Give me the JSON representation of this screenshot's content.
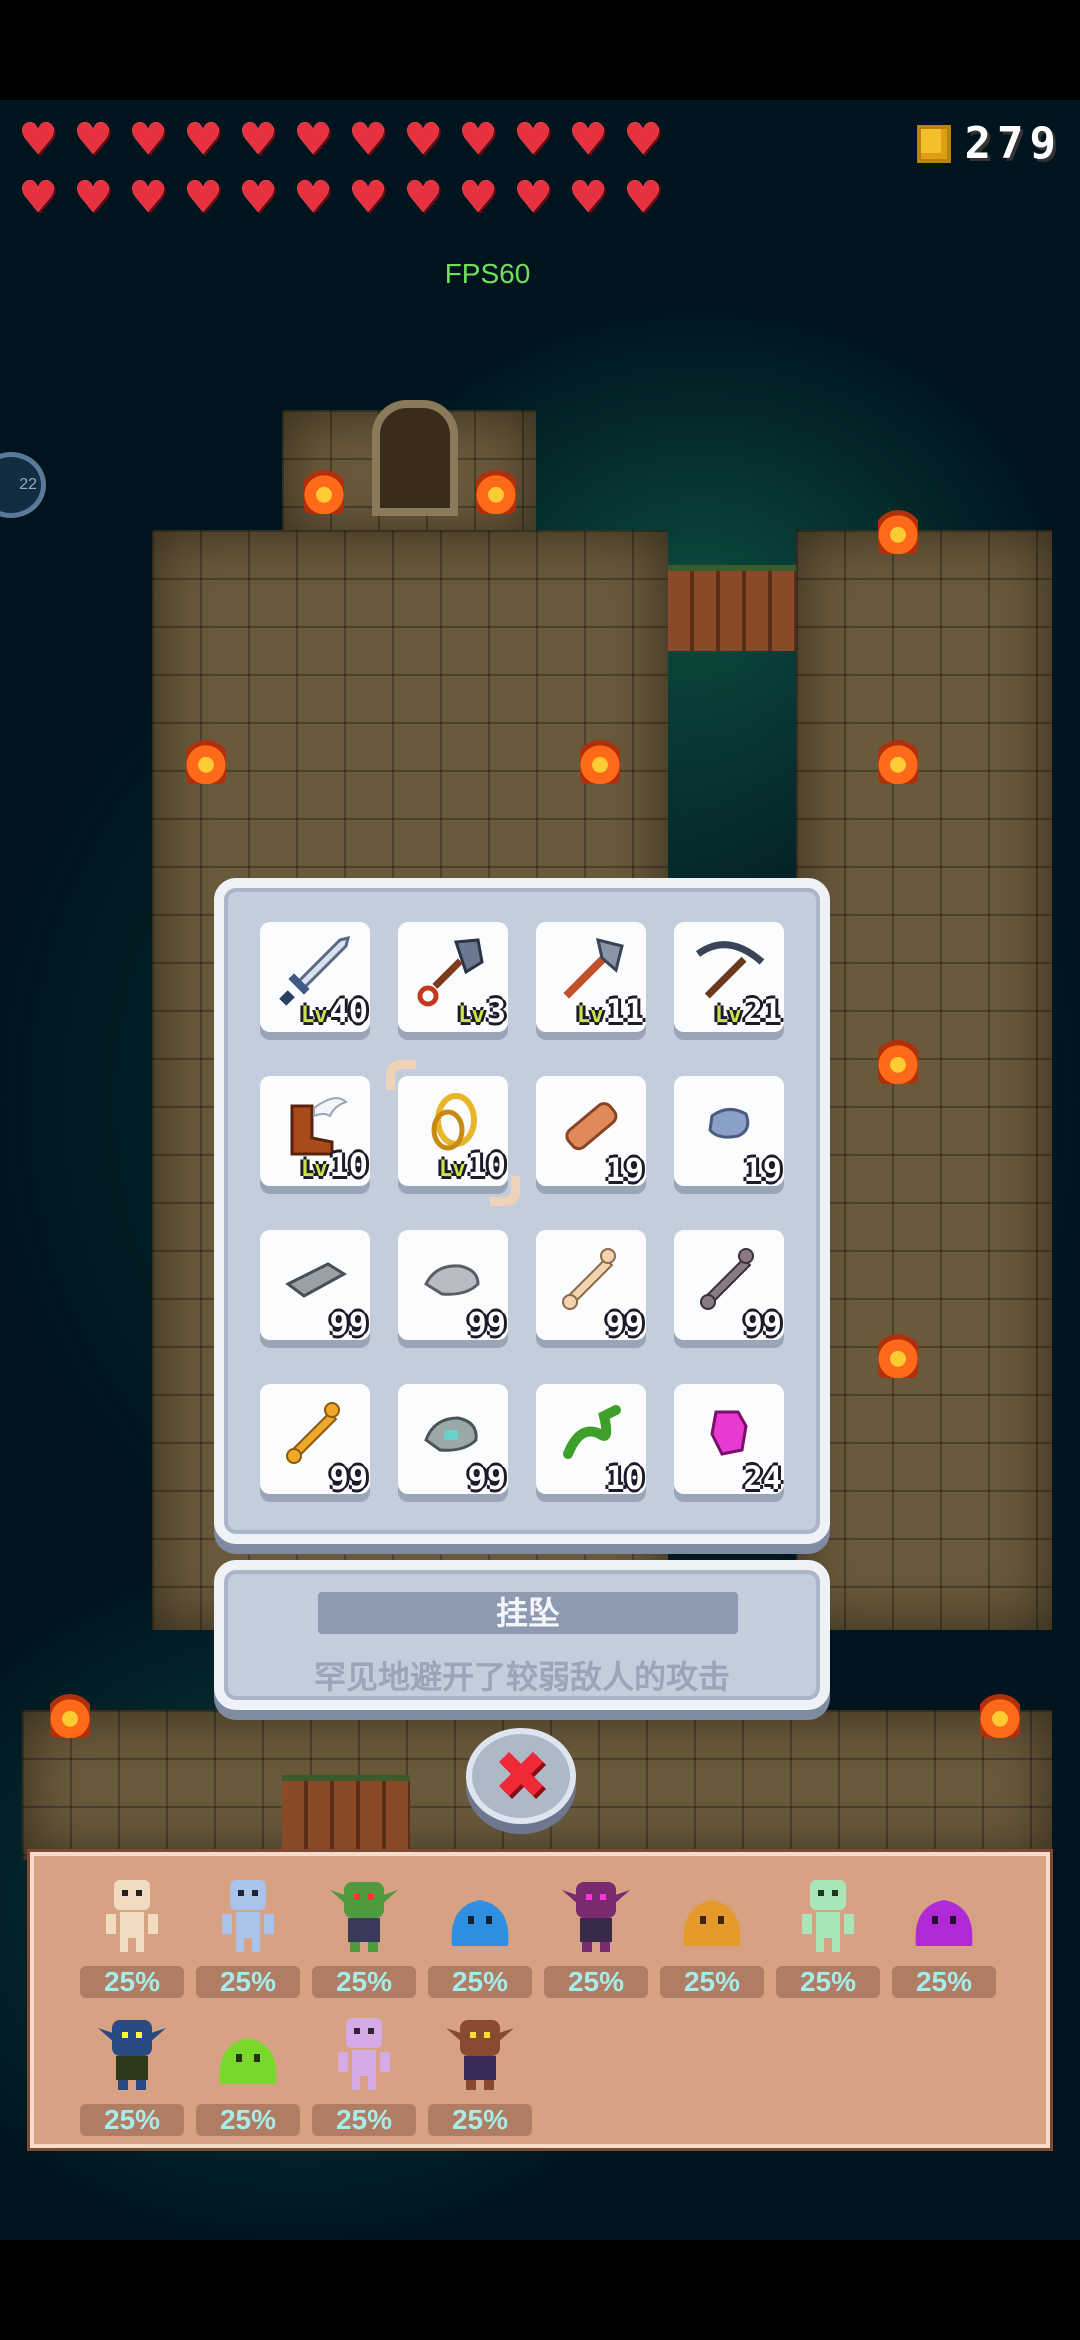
{
  "hud": {
    "hearts_row1": [
      "♥",
      "♥",
      "♥",
      "♥",
      "♥",
      "♥",
      "♥",
      "♥",
      "♥",
      "♥",
      "♥",
      "♥"
    ],
    "hearts_row2": [
      "♥",
      "♥",
      "♥",
      "♥",
      "♥",
      "♥",
      "♥",
      "♥",
      "♥",
      "♥",
      "♥",
      "♥"
    ],
    "coin_count": "279",
    "fps": "FPS60",
    "side_badge": "22"
  },
  "inventory": {
    "slots": [
      {
        "name": "sword",
        "count": "40",
        "lv": "Lv"
      },
      {
        "name": "shovel",
        "count": "3",
        "lv": "Lv"
      },
      {
        "name": "axe",
        "count": "11",
        "lv": "Lv"
      },
      {
        "name": "pickaxe",
        "count": "21",
        "lv": "Lv"
      },
      {
        "name": "winged-boots",
        "count": "10",
        "lv": "Lv"
      },
      {
        "name": "pendant",
        "count": "10",
        "lv": "Lv",
        "selected": true
      },
      {
        "name": "wood-log",
        "count": "19",
        "lv": ""
      },
      {
        "name": "stone",
        "count": "19",
        "lv": ""
      },
      {
        "name": "iron-ingot",
        "count": "99",
        "lv": ""
      },
      {
        "name": "silver-ore",
        "count": "99",
        "lv": ""
      },
      {
        "name": "bone",
        "count": "99",
        "lv": ""
      },
      {
        "name": "dark-bone",
        "count": "99",
        "lv": ""
      },
      {
        "name": "gold-bone",
        "count": "99",
        "lv": ""
      },
      {
        "name": "gem-ore",
        "count": "99",
        "lv": ""
      },
      {
        "name": "green-worm",
        "count": "10",
        "lv": ""
      },
      {
        "name": "pink-gem",
        "count": "24",
        "lv": ""
      }
    ]
  },
  "description": {
    "name": "挂坠",
    "text": "罕见地避开了较弱敌人的攻击"
  },
  "close_label": "✖",
  "monsters": [
    {
      "name": "bone-skeleton",
      "pct": "25%",
      "color": "#f2dcc0"
    },
    {
      "name": "blue-skeleton",
      "pct": "25%",
      "color": "#a9c3ea"
    },
    {
      "name": "green-goblin",
      "pct": "25%",
      "color": "#4f9a3e"
    },
    {
      "name": "blue-slime",
      "pct": "25%",
      "color": "#2f8fe0"
    },
    {
      "name": "purple-goblin",
      "pct": "25%",
      "color": "#7a2a70"
    },
    {
      "name": "orange-slime",
      "pct": "25%",
      "color": "#e59a2c"
    },
    {
      "name": "mint-skeleton",
      "pct": "25%",
      "color": "#a7e6b6"
    },
    {
      "name": "purple-slime",
      "pct": "25%",
      "color": "#b22ad8"
    },
    {
      "name": "navy-goblin",
      "pct": "25%",
      "color": "#2a4a86"
    },
    {
      "name": "green-slime",
      "pct": "25%",
      "color": "#7ad82a"
    },
    {
      "name": "lilac-skeleton",
      "pct": "25%",
      "color": "#d5a8e6"
    },
    {
      "name": "brown-goblin",
      "pct": "25%",
      "color": "#8a4a30"
    }
  ]
}
